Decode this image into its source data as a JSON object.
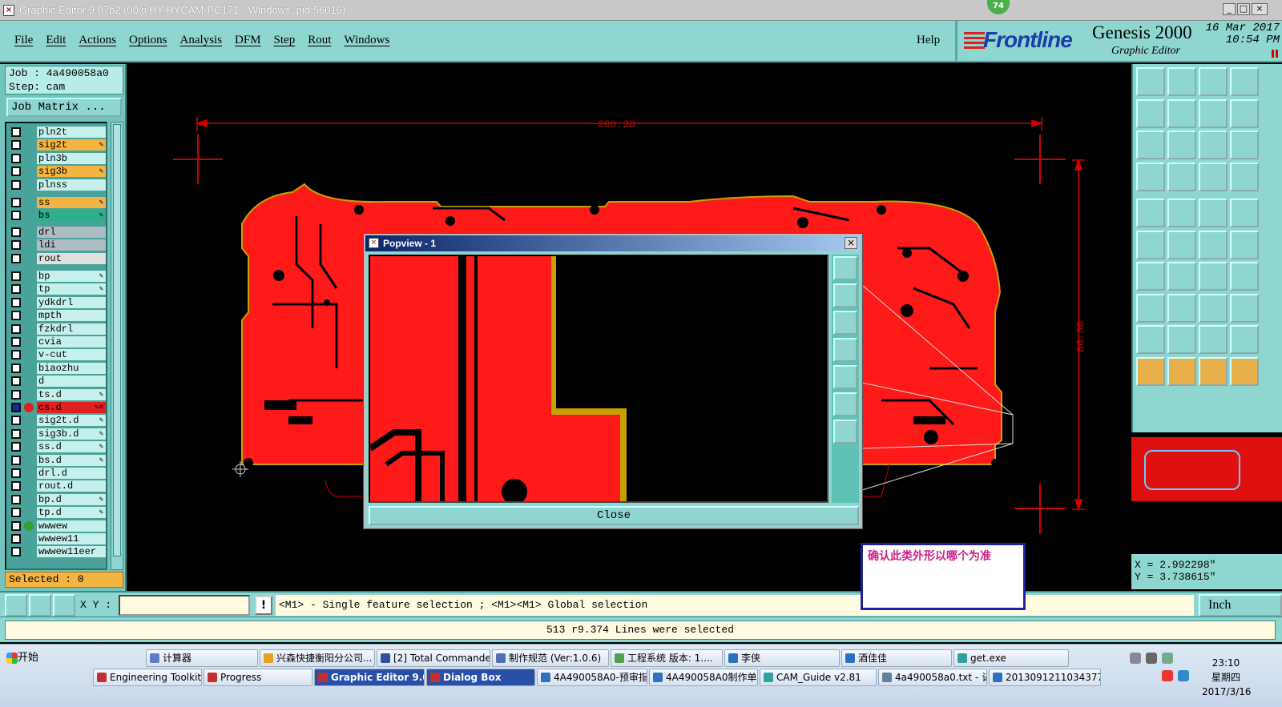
{
  "window": {
    "title": "Graphic Editor 9.07b2 (00@HY-HYCAM-PC171 - Windows, pid:56016)",
    "badge": "74",
    "minimize": "_",
    "maximize": "□",
    "close": "×"
  },
  "menu": {
    "items": [
      "File",
      "Edit",
      "Actions",
      "Options",
      "Analysis",
      "DFM",
      "Step",
      "Rout",
      "Windows"
    ],
    "help": "Help"
  },
  "brand": {
    "logo": "Frontline",
    "product": "Genesis 2000",
    "subtitle": "Graphic Editor",
    "date": "16 Mar 2017",
    "time": "10:54 PM"
  },
  "job": {
    "job_line": "Job : 4a490058a0",
    "step_line": "Step: cam",
    "matrix_button": "Job Matrix ...",
    "selected": "Selected : 0"
  },
  "layers": [
    {
      "name": "pln2t",
      "color": "#c6f0ec",
      "mark": ""
    },
    {
      "name": "sig2t",
      "color": "#f4b442",
      "mark": "✎"
    },
    {
      "name": "pln3b",
      "color": "#c6f0ec",
      "mark": ""
    },
    {
      "name": "sig3b",
      "color": "#f4b442",
      "mark": "✎"
    },
    {
      "name": "plnss",
      "color": "#c6f0ec",
      "mark": ""
    },
    {
      "name": "ss",
      "color": "#f4b442",
      "mark": "✎"
    },
    {
      "name": "bs",
      "color": "#2fae8a",
      "mark": "✎"
    },
    {
      "name": "drl",
      "color": "#b0bcc4",
      "mark": ""
    },
    {
      "name": "ldi",
      "color": "#b0bcc4",
      "mark": ""
    },
    {
      "name": "rout",
      "color": "#e0e0e0",
      "mark": ""
    },
    {
      "name": "bp",
      "color": "#c6f0ec",
      "mark": "✎"
    },
    {
      "name": "tp",
      "color": "#c6f0ec",
      "mark": "✎"
    },
    {
      "name": "ydkdrl",
      "color": "#c6f0ec",
      "mark": ""
    },
    {
      "name": "mpth",
      "color": "#c6f0ec",
      "mark": ""
    },
    {
      "name": "fzkdrl",
      "color": "#c6f0ec",
      "mark": ""
    },
    {
      "name": "cvia",
      "color": "#c6f0ec",
      "mark": ""
    },
    {
      "name": "v-cut",
      "color": "#c6f0ec",
      "mark": ""
    },
    {
      "name": "biaozhu",
      "color": "#c6f0ec",
      "mark": ""
    },
    {
      "name": "d",
      "color": "#c6f0ec",
      "mark": ""
    },
    {
      "name": "ts.d",
      "color": "#c6f0ec",
      "mark": "✎"
    },
    {
      "name": "cs.d",
      "color": "#e02020",
      "mark": "✎≡",
      "indicator": "#e02020"
    },
    {
      "name": "sig2t.d",
      "color": "#c6f0ec",
      "mark": "✎"
    },
    {
      "name": "sig3b.d",
      "color": "#c6f0ec",
      "mark": "✎"
    },
    {
      "name": "ss.d",
      "color": "#c6f0ec",
      "mark": "✎"
    },
    {
      "name": "bs.d",
      "color": "#c6f0ec",
      "mark": "✎"
    },
    {
      "name": "drl.d",
      "color": "#c6f0ec",
      "mark": ""
    },
    {
      "name": "rout.d",
      "color": "#c6f0ec",
      "mark": ""
    },
    {
      "name": "bp.d",
      "color": "#c6f0ec",
      "mark": "✎"
    },
    {
      "name": "tp.d",
      "color": "#c6f0ec",
      "mark": "✎"
    },
    {
      "name": "wwwew",
      "color": "#c6f0ec",
      "mark": "",
      "indicator": "#30a030"
    },
    {
      "name": "wwwew11",
      "color": "#c6f0ec",
      "mark": ""
    },
    {
      "name": "wwwew11eer",
      "color": "#c6f0ec",
      "mark": ""
    }
  ],
  "canvas": {
    "dim_width": "208.28",
    "dim_height": "86.36"
  },
  "popview": {
    "title": "Popview - 1",
    "close_label": "Close"
  },
  "coords": {
    "x": "X = 2.992298\"",
    "y": "Y = 3.738615\""
  },
  "command": {
    "xy_label": "X Y :",
    "xy_value": "",
    "excl": "!",
    "hint": "<M1> - Single feature selection ; <M1><M1> Global selection",
    "units": "Inch"
  },
  "status": {
    "message": "513 r9.374 Lines were selected"
  },
  "note": {
    "text": "确认此类外形以哪个为准"
  },
  "taskbar": {
    "start": "开始",
    "row1": [
      {
        "label": "计算器",
        "color": "#5a7fc8"
      },
      {
        "label": "兴森快捷衡阳分公司...",
        "color": "#e8a020"
      },
      {
        "label": "[2] Total Commander ...",
        "color": "#3050a0"
      },
      {
        "label": "制作规范 (Ver:1.0.6)",
        "color": "#5070b0"
      },
      {
        "label": "工程系统  版本: 1....",
        "color": "#50a050"
      },
      {
        "label": "李侠",
        "color": "#2a70c8"
      },
      {
        "label": "酒佳佳",
        "color": "#2a70c8"
      },
      {
        "label": "get.exe",
        "color": "#30a0a0"
      }
    ],
    "row2": [
      {
        "label": "Engineering Toolkit 9....",
        "color": "#c03030"
      },
      {
        "label": "Progress",
        "color": "#c03030"
      },
      {
        "label": "Graphic Editor 9.07...",
        "color": "#c03030",
        "active": true
      },
      {
        "label": "Dialog Box",
        "color": "#c03030",
        "active": true
      },
      {
        "label": "4A490058A0-预审指...",
        "color": "#3070c0"
      },
      {
        "label": "4A490058A0制作单....",
        "color": "#3070c0"
      },
      {
        "label": "CAM_Guide v2.81",
        "color": "#30a0a0"
      },
      {
        "label": "4a490058a0.txt - 记...",
        "color": "#6080a0"
      },
      {
        "label": "20130912110343773...",
        "color": "#3070c0"
      }
    ],
    "clock_time": "23:10",
    "clock_day": "星期四",
    "clock_date": "2017/3/16"
  }
}
